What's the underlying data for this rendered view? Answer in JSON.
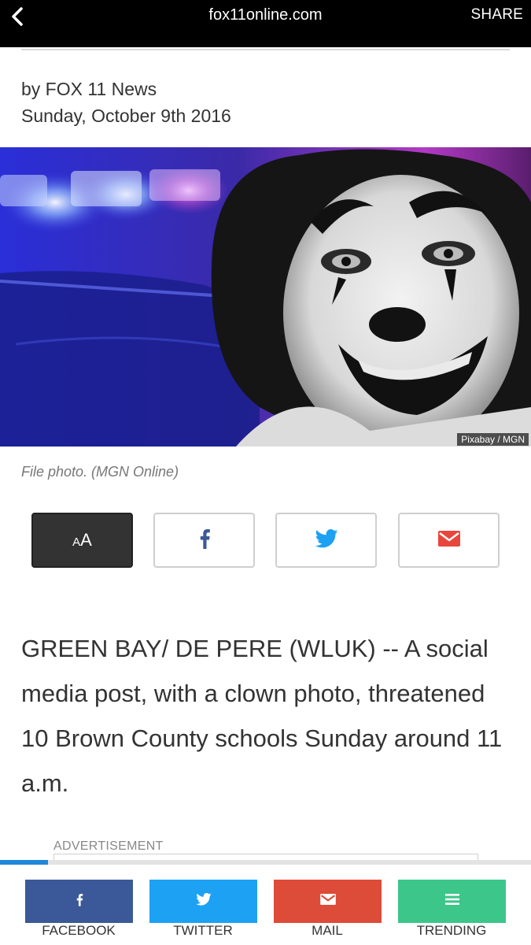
{
  "top_bar": {
    "domain": "fox11online.com",
    "share_label": "SHARE"
  },
  "article": {
    "byline": "by FOX 11 News",
    "date": "Sunday, October 9th 2016",
    "image_credit": "Pixabay / MGN",
    "caption": "File photo. (MGN Online)",
    "body": "GREEN BAY/ DE PERE (WLUK) -- A social media post, with a clown photo, threatened 10 Brown County schools Sunday around 11 a.m."
  },
  "share_buttons": {
    "font_size_small": "A",
    "font_size_large": "A",
    "icons": [
      "font-size-icon",
      "facebook-icon",
      "twitter-icon",
      "mail-icon"
    ]
  },
  "advertisement_label": "ADVERTISEMENT",
  "read_progress": 0.09,
  "bottom_bar": {
    "facebook": "FACEBOOK",
    "twitter": "TWITTER",
    "mail": "MAIL",
    "trending": "TRENDING"
  },
  "colors": {
    "facebook": "#3b5998",
    "twitter": "#1da1f2",
    "mail": "#dd4b39",
    "trending": "#3cc68a",
    "progress": "#1e88d8"
  }
}
